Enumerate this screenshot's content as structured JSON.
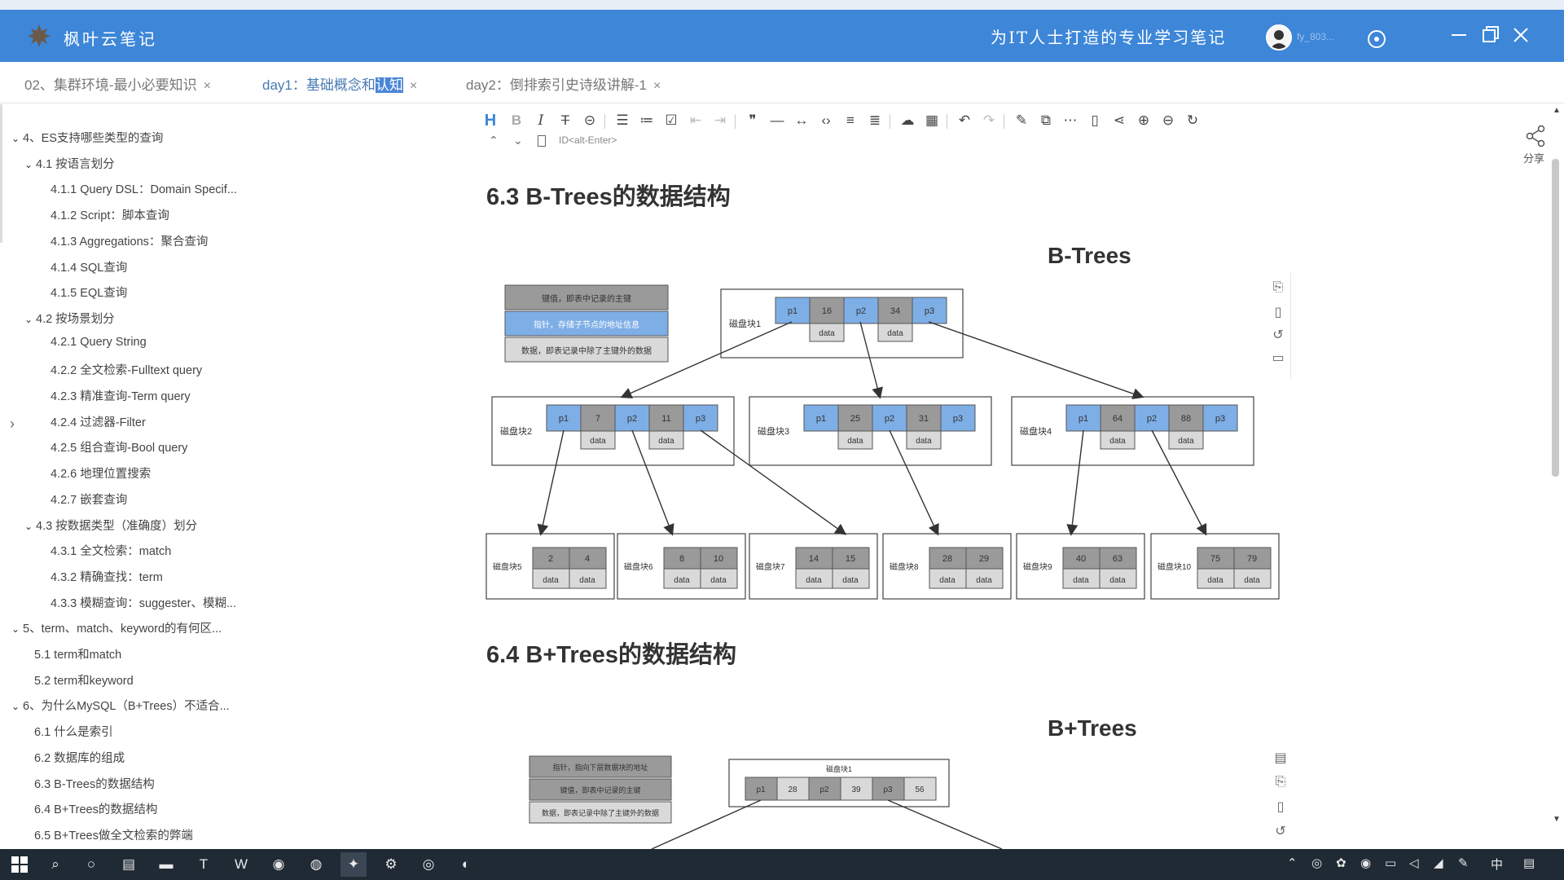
{
  "app": {
    "name": "枫叶云笔记",
    "slogan": "为IT人士打造的专业学习笔记",
    "username": "fy_803...",
    "brand_color": "#3d86d8"
  },
  "tabs": [
    {
      "label": "02、集群环境-最小必要知识",
      "close": "×"
    },
    {
      "label_prefix": "day1：基础概念和",
      "label_highlight": "认知",
      "close": "×"
    },
    {
      "label": "day2：倒排索引史诗级讲解-1",
      "close": "×"
    }
  ],
  "toc": [
    {
      "text": "4、ES支持哪些类型的查询",
      "level": 0,
      "chev": "v"
    },
    {
      "text": "4.1 按语言划分",
      "level": 1,
      "chev": "v"
    },
    {
      "text": "4.1.1 Query DSL：Domain Specif...",
      "level": 2
    },
    {
      "text": "4.1.2 Script：脚本查询",
      "level": 2
    },
    {
      "text": "4.1.3 Aggregations：聚合查询",
      "level": 2
    },
    {
      "text": "4.1.4 SQL查询",
      "level": 2
    },
    {
      "text": "4.1.5 EQL查询",
      "level": 2
    },
    {
      "text": "4.2 按场景划分",
      "level": 1,
      "chev": "v"
    },
    {
      "text": "4.2.1 Query String",
      "level": 2
    },
    {
      "text": "4.2.2 全文检索-Fulltext query",
      "level": 2
    },
    {
      "text": "4.2.3 精准查询-Term query",
      "level": 2
    },
    {
      "text": "4.2.4 过滤器-Filter",
      "level": 2
    },
    {
      "text": "4.2.5 组合查询-Bool query",
      "level": 2
    },
    {
      "text": "4.2.6 地理位置搜索",
      "level": 2
    },
    {
      "text": "4.2.7 嵌套查询",
      "level": 2
    },
    {
      "text": "4.3 按数据类型（准确度）划分",
      "level": 1,
      "chev": "v"
    },
    {
      "text": "4.3.1 全文检索：match",
      "level": 2
    },
    {
      "text": "4.3.2 精确查找：term",
      "level": 2
    },
    {
      "text": "4.3.3 模糊查询：suggester、模糊...",
      "level": 2
    },
    {
      "text": "5、term、match、keyword的有何区...",
      "level": 0,
      "chev": "v"
    },
    {
      "text": "5.1 term和match",
      "level": 1
    },
    {
      "text": "5.2 term和keyword",
      "level": 1
    },
    {
      "text": "6、为什么MySQL（B+Trees）不适合...",
      "level": 0,
      "chev": "v"
    },
    {
      "text": "6.1 什么是索引",
      "level": 1
    },
    {
      "text": "6.2 数据库的组成",
      "level": 1
    },
    {
      "text": "6.3 B-Trees的数据结构",
      "level": 1
    },
    {
      "text": "6.4 B+Trees的数据结构",
      "level": 1
    },
    {
      "text": "6.5 B+Trees做全文检索的弊端",
      "level": 1
    }
  ],
  "toolbar": {
    "hint": "ID<alt-Enter>"
  },
  "share_label": "分享",
  "content": {
    "h_63": "6.3 B-Trees的数据结构",
    "fig1_title": "B-Trees",
    "legend1": [
      "键值，即表中记录的主键",
      "指针，存储子节点的地址信息",
      "数据，即表记录中除了主键外的数据"
    ],
    "root_label": "磁盘块1",
    "root_cells": [
      "p1",
      "16",
      "p2",
      "34",
      "p3"
    ],
    "mid_nodes": [
      {
        "label": "磁盘块2",
        "cells": [
          "p1",
          "7",
          "p2",
          "11",
          "p3"
        ]
      },
      {
        "label": "磁盘块3",
        "cells": [
          "p1",
          "25",
          "p2",
          "31",
          "p3"
        ]
      },
      {
        "label": "磁盘块4",
        "cells": [
          "p1",
          "64",
          "p2",
          "88",
          "p3"
        ]
      }
    ],
    "leaf_nodes": [
      {
        "label": "磁盘块5",
        "keys": [
          "2",
          "4"
        ]
      },
      {
        "label": "磁盘块6",
        "keys": [
          "8",
          "10"
        ]
      },
      {
        "label": "磁盘块7",
        "keys": [
          "14",
          "15"
        ]
      },
      {
        "label": "磁盘块8",
        "keys": [
          "28",
          "29"
        ]
      },
      {
        "label": "磁盘块9",
        "keys": [
          "40",
          "63"
        ]
      },
      {
        "label": "磁盘块10",
        "keys": [
          "75",
          "79"
        ]
      }
    ],
    "data_label": "data",
    "h_64": "6.4 B+Trees的数据结构",
    "fig2_title": "B+Trees",
    "legend2": [
      "指针，指向下层数据块的地址",
      "键值，即表中记录的主键",
      "数据，即表记录中除了主键外的数据"
    ],
    "bplus_root_label": "磁盘块1",
    "bplus_root_cells": [
      "p1",
      "28",
      "p2",
      "39",
      "p3",
      "56"
    ]
  },
  "taskbar": {
    "ime": "中"
  }
}
